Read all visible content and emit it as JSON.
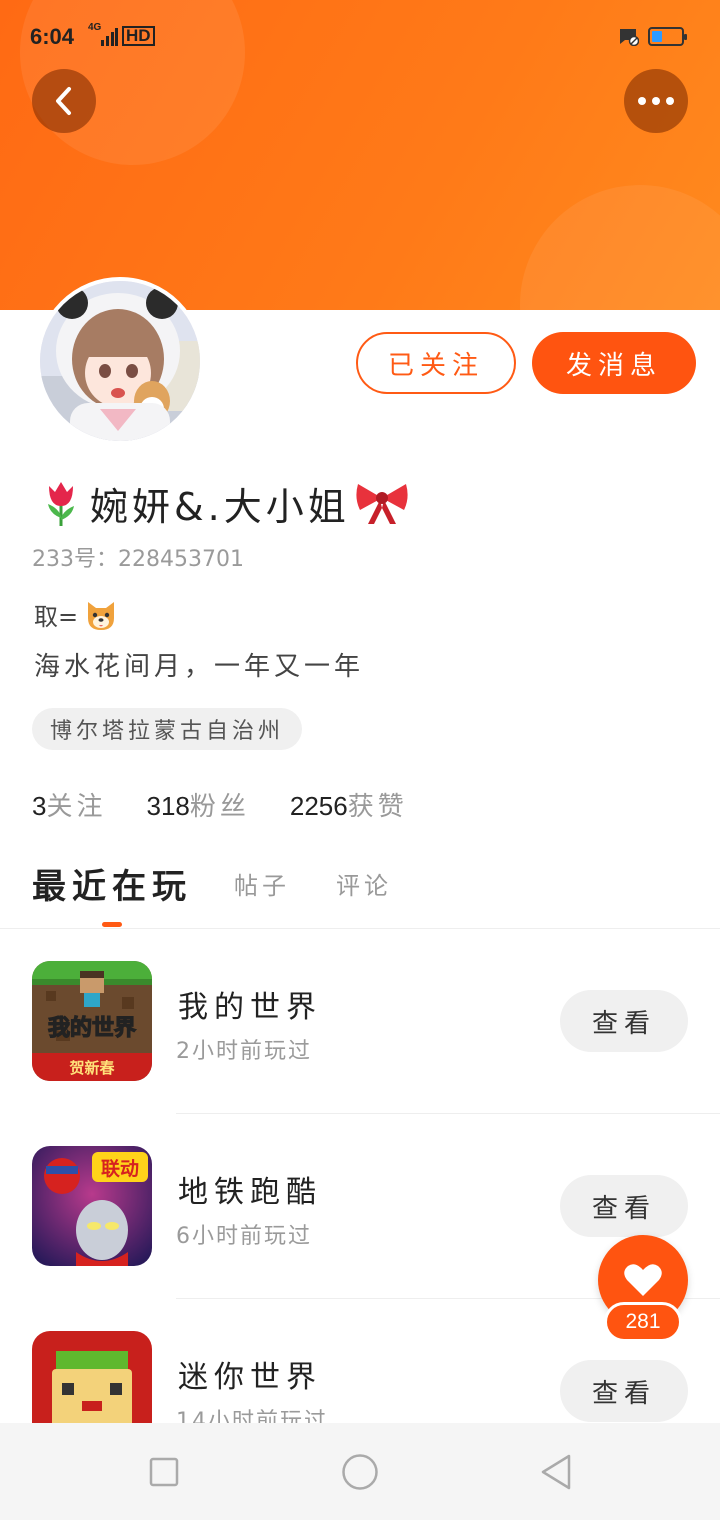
{
  "status_bar": {
    "time": "6:04",
    "network": "4G",
    "hd": "HD",
    "battery_color": "#2e9bff"
  },
  "profile": {
    "follow_label": "已关注",
    "message_label": "发消息",
    "username": "婉妍&.大小姐",
    "uid_text": "233号：228453701",
    "bio_line1": "取=",
    "bio_line2": "海水花间月，一年又一年",
    "location": "博尔塔拉蒙古自治州",
    "stats": [
      {
        "value": "3",
        "label": "关注"
      },
      {
        "value": "318",
        "label": "粉丝"
      },
      {
        "value": "2256",
        "label": "获赞"
      }
    ]
  },
  "tabs": [
    {
      "label": "最近在玩",
      "active": true
    },
    {
      "label": "帖子",
      "active": false
    },
    {
      "label": "评论",
      "active": false
    }
  ],
  "games": [
    {
      "name": "我的世界",
      "last_played": "2小时前玩过",
      "action": "查看",
      "icon": "minecraft-icon",
      "icon_text": "我的世界",
      "badge": "贺新春"
    },
    {
      "name": "地铁跑酷",
      "last_played": "6小时前玩过",
      "action": "查看",
      "icon": "subway-surfers-icon",
      "badge": "联动"
    },
    {
      "name": "迷你世界",
      "last_played": "14小时前玩过",
      "action": "查看",
      "icon": "mini-world-icon"
    }
  ],
  "like": {
    "count": "281"
  },
  "accent_color": "#ff5410"
}
